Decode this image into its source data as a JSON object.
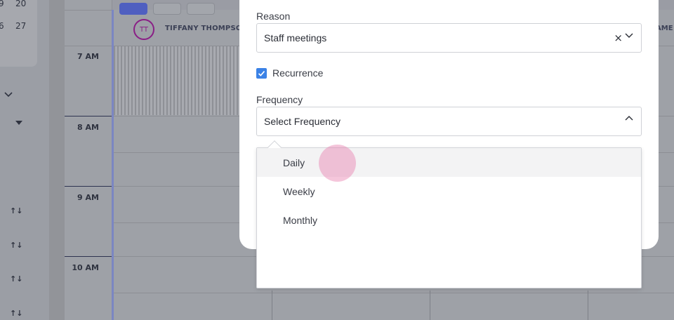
{
  "mini_calendar": {
    "row1": [
      "9",
      "20"
    ],
    "row2": [
      "6",
      "27"
    ]
  },
  "schedule": {
    "times": [
      "7 AM",
      "8 AM",
      "9 AM",
      "10 AM"
    ],
    "provider": {
      "initials": "TT",
      "name": "TIFFANY THOMPSO",
      "name_cut": "AME"
    }
  },
  "modal": {
    "reason": {
      "label": "Reason",
      "value": "Staff meetings"
    },
    "recurrence": {
      "label": "Recurrence",
      "checked": true
    },
    "frequency": {
      "label": "Frequency",
      "placeholder": "Select Frequency"
    }
  },
  "dropdown": {
    "options": [
      "Daily",
      "Weekly",
      "Monthly"
    ],
    "hovered": "Daily"
  },
  "colors": {
    "accent": "#3b82e6",
    "avatar": "#8a1f86",
    "ripple": "#e878aa"
  }
}
